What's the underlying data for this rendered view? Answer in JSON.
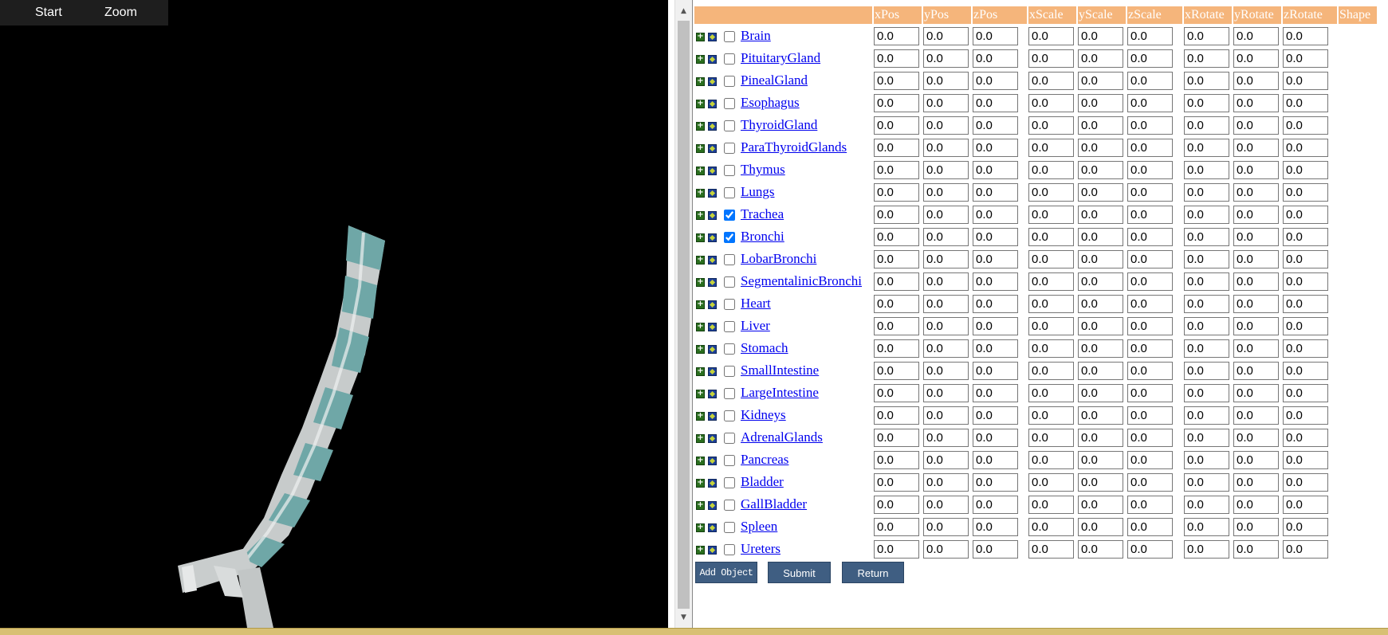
{
  "nav": {
    "start": "Start",
    "zoom": "Zoom"
  },
  "headers": [
    "xPos",
    "yPos",
    "zPos",
    "xScale",
    "yScale",
    "zScale",
    "xRotate",
    "yRotate",
    "zRotate",
    "Shape"
  ],
  "rows": [
    {
      "name": "Brain",
      "checked": false
    },
    {
      "name": "PituitaryGland",
      "checked": false
    },
    {
      "name": "PinealGland",
      "checked": false
    },
    {
      "name": "Esophagus",
      "checked": false
    },
    {
      "name": "ThyroidGland",
      "checked": false
    },
    {
      "name": "ParaThyroidGlands",
      "checked": false
    },
    {
      "name": "Thymus",
      "checked": false
    },
    {
      "name": "Lungs",
      "checked": false
    },
    {
      "name": "Trachea",
      "checked": true
    },
    {
      "name": "Bronchi",
      "checked": true
    },
    {
      "name": "LobarBronchi",
      "checked": false
    },
    {
      "name": "SegmentalinicBronchi",
      "checked": false
    },
    {
      "name": "Heart",
      "checked": false
    },
    {
      "name": "Liver",
      "checked": false
    },
    {
      "name": "Stomach",
      "checked": false
    },
    {
      "name": "SmallIntestine",
      "checked": false
    },
    {
      "name": "LargeIntestine",
      "checked": false
    },
    {
      "name": "Kidneys",
      "checked": false
    },
    {
      "name": "AdrenalGlands",
      "checked": false
    },
    {
      "name": "Pancreas",
      "checked": false
    },
    {
      "name": "Bladder",
      "checked": false
    },
    {
      "name": "GallBladder",
      "checked": false
    },
    {
      "name": "Spleen",
      "checked": false
    },
    {
      "name": "Ureters",
      "checked": false
    }
  ],
  "default_value": "0.0",
  "buttons": {
    "add_object": "Add Object",
    "submit": "Submit",
    "return": "Return"
  },
  "colors": {
    "header": "#f5b57b",
    "button": "#3f5e82",
    "link": "#0000ee",
    "tube": "#7fb1b1"
  },
  "icons": {
    "scroll_up": "▲",
    "scroll_down": "▼",
    "expand": "+"
  }
}
